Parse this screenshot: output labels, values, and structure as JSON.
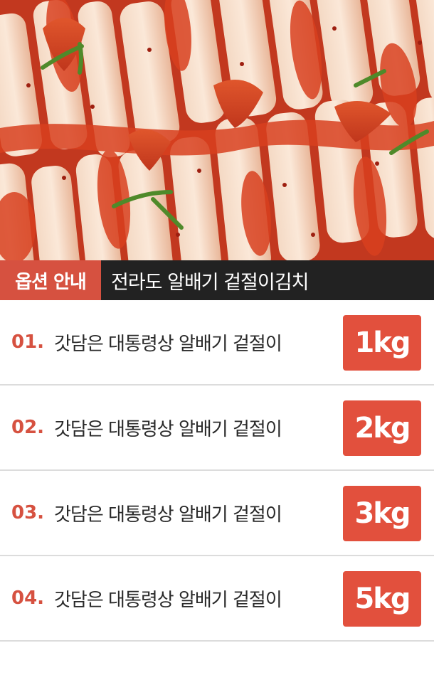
{
  "banner": {
    "tag": "옵션 안내",
    "title": "전라도 알배기 겉절이김치"
  },
  "options": [
    {
      "num": "01.",
      "label": "갓담은 대통령상 알배기 겉절이",
      "weight": "1kg"
    },
    {
      "num": "02.",
      "label": "갓담은 대통령상 알배기 겉절이",
      "weight": "2kg"
    },
    {
      "num": "03.",
      "label": "갓담은 대통령상 알배기 겉절이",
      "weight": "3kg"
    },
    {
      "num": "04.",
      "label": "갓담은 대통령상 알배기 겉절이",
      "weight": "5kg"
    }
  ],
  "colors": {
    "accent": "#d65140",
    "weight_badge": "#e2503d",
    "banner_bg": "#222222"
  },
  "hero_image": "kimchi-photo"
}
